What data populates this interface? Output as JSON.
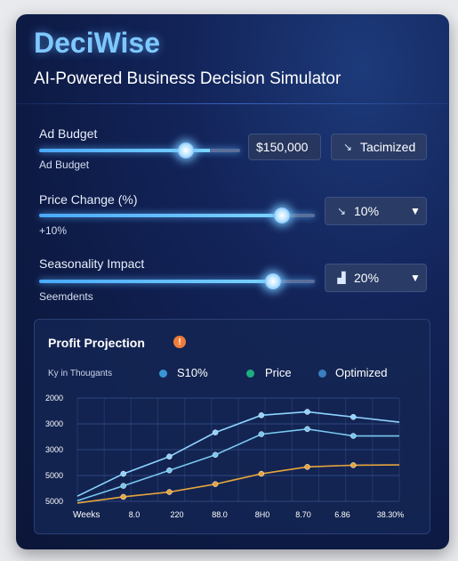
{
  "app": {
    "name": "DeciWise",
    "subtitle": "AI-Powered Business Decision Simulator"
  },
  "controls": [
    {
      "label": "Ad Budget",
      "sublabel": "Ad Budget",
      "slider_value": 0.68,
      "field_value": "$150,000",
      "button_icon": "wand-icon",
      "button_label": "Tacimized"
    },
    {
      "label": "Price Change (%)",
      "sublabel": "+10%",
      "slider_value": 0.88,
      "select_icon": "cursor-icon",
      "select_value": "10%"
    },
    {
      "label": "Seasonality Impact",
      "sublabel": "Seemdents",
      "slider_value": 0.85,
      "select_icon": "chart-icon",
      "select_value": "20%"
    }
  ],
  "chart_panel": {
    "title": "Profit Projection",
    "info_badge": "!",
    "unit_label": "Ky in Thougants",
    "legend": [
      {
        "label": "S10%",
        "color": "#3a95d8"
      },
      {
        "label": "Price",
        "color": "#1fae7f"
      },
      {
        "label": "Optimized",
        "color": "#3a7fc0"
      }
    ]
  },
  "chart_data": {
    "type": "line",
    "xlabel": "Weeks",
    "categories": [
      "8.0",
      "220",
      "88.0",
      "8H0",
      "8.70",
      "6.86",
      "38.30%"
    ],
    "y_ticks": [
      "2000",
      "3000",
      "3000",
      "5000",
      "5000"
    ],
    "ylim": [
      2000,
      5000
    ],
    "grid": true,
    "series": [
      {
        "name": "S10%",
        "color": "#8fd3ff",
        "values": [
          2150,
          2800,
          3300,
          4000,
          4500,
          4600,
          4450,
          4300
        ]
      },
      {
        "name": "Optimized",
        "color": "#79c7f0",
        "values": [
          2020,
          2450,
          2900,
          3350,
          3950,
          4100,
          3900,
          3900
        ]
      },
      {
        "name": "Price",
        "color": "#e5a43b",
        "values": [
          1950,
          2130,
          2270,
          2500,
          2800,
          3000,
          3050,
          3060
        ]
      }
    ],
    "marker_points": 7
  }
}
